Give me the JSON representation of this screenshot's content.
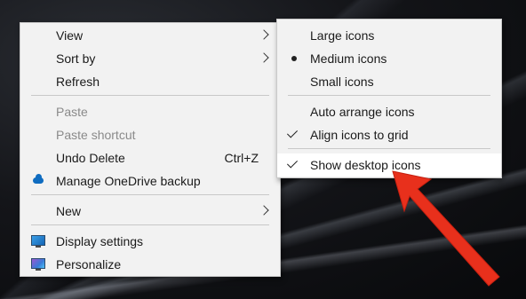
{
  "context_menu": {
    "items": [
      {
        "label": "View",
        "has_submenu": true
      },
      {
        "label": "Sort by",
        "has_submenu": true
      },
      {
        "label": "Refresh"
      },
      {
        "label": "Paste",
        "disabled": true
      },
      {
        "label": "Paste shortcut",
        "disabled": true
      },
      {
        "label": "Undo Delete",
        "shortcut": "Ctrl+Z"
      },
      {
        "label": "Manage OneDrive backup",
        "icon": "cloud-icon"
      },
      {
        "label": "New",
        "has_submenu": true
      },
      {
        "label": "Display settings",
        "icon": "monitor-icon"
      },
      {
        "label": "Personalize",
        "icon": "personalize-icon"
      }
    ]
  },
  "view_submenu": {
    "items": [
      {
        "label": "Large icons"
      },
      {
        "label": "Medium icons",
        "selected": true,
        "icon": "bullet-icon"
      },
      {
        "label": "Small icons"
      },
      {
        "label": "Auto arrange icons"
      },
      {
        "label": "Align icons to grid",
        "checked": true,
        "icon": "check-icon"
      },
      {
        "label": "Show desktop icons",
        "checked": true,
        "icon": "check-icon"
      }
    ]
  },
  "colors": {
    "menu_background": "#f2f2f2",
    "annotation_arrow": "#e8301c"
  }
}
